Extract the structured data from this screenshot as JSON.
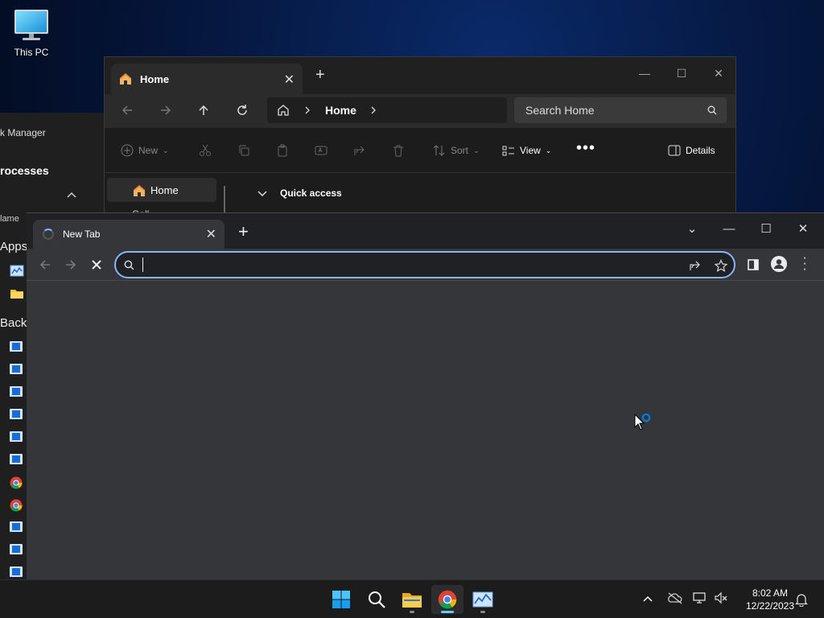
{
  "desktop": {
    "icon_label": "This PC"
  },
  "task_manager": {
    "title": "k Manager",
    "section": "rocesses",
    "column_name": "lame",
    "group_apps": "Apps",
    "group_background": "Backg"
  },
  "explorer": {
    "tab_title": "Home",
    "breadcrumb": "Home",
    "search_placeholder": "Search Home",
    "commands": {
      "new": "New",
      "sort": "Sort",
      "view": "View",
      "details": "Details"
    },
    "sidebar": {
      "home": "Home",
      "next_partial": "Gall"
    },
    "quick_access": "Quick access"
  },
  "chrome": {
    "tab_title": "New Tab",
    "omnibox_value": "",
    "omnibox_placeholder": ""
  },
  "taskbar": {
    "time": "8:02 AM",
    "date": "12/22/2023"
  },
  "colors": {
    "accent": "#60cdff",
    "chrome_focus": "#8ab4f8",
    "windows_blue": "#0078d4"
  }
}
